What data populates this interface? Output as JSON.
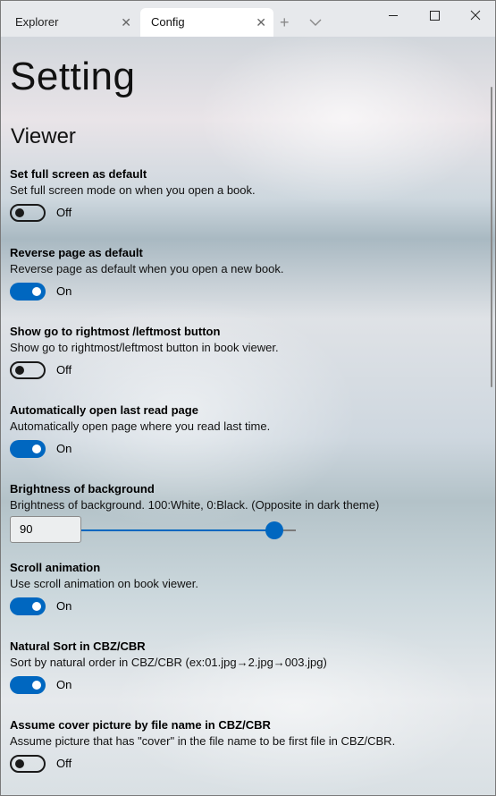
{
  "tabs": [
    {
      "label": "Explorer",
      "active": false
    },
    {
      "label": "Config",
      "active": true
    }
  ],
  "tab_close_glyph": "✕",
  "new_tab_glyph": "+",
  "page_title": "Setting",
  "section_title": "Viewer",
  "settings": [
    {
      "title": "Set full screen as default",
      "description": "Set full screen mode on when you open a book.",
      "state": "Off"
    },
    {
      "title": "Reverse page as default",
      "description": "Reverse page as default when you open a new book.",
      "state": "On"
    },
    {
      "title": "Show go to rightmost /leftmost button",
      "description": "Show go to rightmost/leftmost button in book viewer.",
      "state": "Off"
    },
    {
      "title": "Automatically open last read page",
      "description": "Automatically open page where you read last time.",
      "state": "On"
    },
    {
      "title": "Brightness of background",
      "description": "Brightness of background. 100:White, 0:Black. (Opposite in dark theme)",
      "value": "90",
      "level_fraction": 0.9
    },
    {
      "title": "Scroll animation",
      "description": "Use scroll animation on book viewer.",
      "state": "On"
    },
    {
      "title": "Natural Sort in CBZ/CBR",
      "description": "Sort by natural order in CBZ/CBR (ex:01.jpg→2.jpg→003.jpg)",
      "state": "On"
    },
    {
      "title": "Assume cover picture by file name in CBZ/CBR",
      "description": "Assume picture that has \"cover\" in  the file name to be first file in CBZ/CBR.",
      "state": "Off"
    }
  ],
  "colors": {
    "accent": "#0067c0",
    "titlebar": "#e7e9ec"
  },
  "icons": {
    "minimize": "minimize-icon",
    "maximize": "maximize-icon",
    "close": "close-icon",
    "tab_menu": "chevron-down-icon"
  }
}
